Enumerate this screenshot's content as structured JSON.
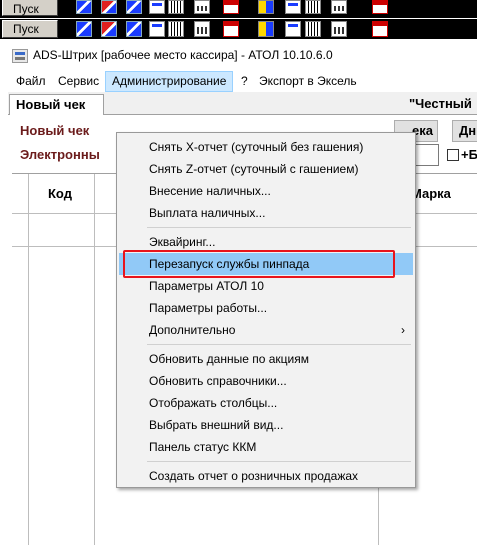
{
  "taskbar": {
    "start_label": "Пуск"
  },
  "window": {
    "title": "ADS-Штрих [рабочее место кассира] - АТОЛ 10.10.6.0"
  },
  "menu": {
    "file": "Файл",
    "service": "Сервис",
    "admin": "Администрирование",
    "help": "?",
    "export": "Экспорт в Эксель"
  },
  "tabs": {
    "new_check": "Новый чек",
    "honest": "\"Честный"
  },
  "form": {
    "new_check_label": "Новый чек",
    "electronic_label": "Электронны",
    "check_button": "ека",
    "dn_button": "Дн",
    "checkbox_label": "+Б"
  },
  "grid": {
    "col_code": "Код",
    "col_mark": "Марка"
  },
  "dropdown": {
    "items": [
      "Снять X-отчет (суточный без гашения)",
      "Снять Z-отчет (суточный с гашением)",
      "Внесение наличных...",
      "Выплата наличных...",
      "Эквайринг...",
      "Перезапуск службы пинпада",
      "Параметры АТОЛ 10",
      "Параметры работы...",
      "Дополнительно",
      "Обновить данные по акциям",
      "Обновить справочники...",
      "Отображать столбцы...",
      "Выбрать внешний вид...",
      "Панель статус ККМ",
      "Создать отчет о розничных продажах"
    ],
    "submenu_arrow": "›",
    "highlight_color": "#91c9f7",
    "annotation_color": "#e8141c"
  },
  "icons": [
    "start-button",
    "rdp-icon",
    "rdp-red-icon",
    "window-icon",
    "grid-icon",
    "calculator-icon",
    "calendar-icon",
    "yellow-app-icon"
  ]
}
